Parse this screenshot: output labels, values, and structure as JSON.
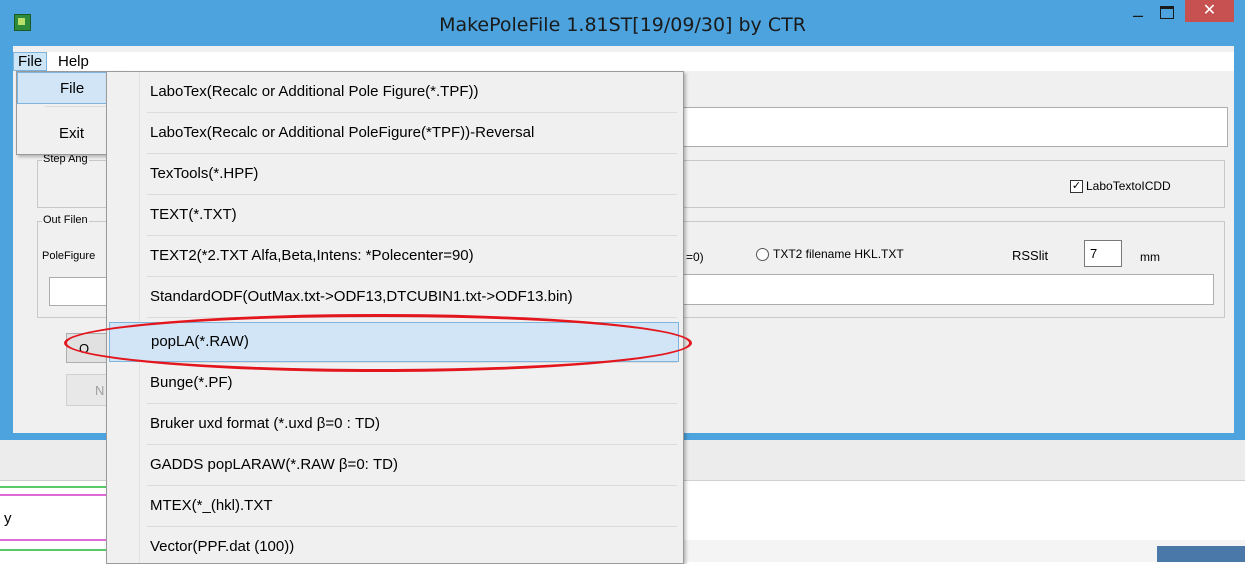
{
  "window": {
    "title": "MakePoleFile 1.81ST[19/09/30] by CTR",
    "minimize": "–",
    "close": "✕"
  },
  "menubar": {
    "file": "File",
    "help": "Help"
  },
  "file_menu": {
    "items": [
      {
        "label": "File",
        "has_submenu": true
      },
      {
        "label": "Exit"
      }
    ]
  },
  "file_submenu": {
    "items": [
      "LaboTex(Recalc or Additional Pole Figure(*.TPF))",
      "LaboTex(Recalc or Additional PoleFigure(*TPF))-Reversal",
      "TexTools(*.HPF)",
      "TEXT(*.TXT)",
      "TEXT2(*2.TXT Alfa,Beta,Intens: *Polecenter=90)",
      "StandardODF(OutMax.txt->ODF13,DTCUBIN1.txt->ODF13.bin)",
      "popLA(*.RAW)",
      "Bunge(*.PF)",
      "Bruker uxd format (*.uxd β=0 : TD)",
      "GADDS popLARAW(*.RAW β=0: TD)",
      "MTEX(*_(hkl).TXT",
      "Vector(PPF.dat (100))"
    ],
    "highlighted_index": 6
  },
  "background": {
    "step_angle_label": "Step Ang",
    "out_filename_label": "Out Filen",
    "pole_figure_label": "PoleFigure",
    "labotex_checkbox_label": "LaboTextoICDD",
    "labotex_checked": true,
    "checkmark": "✓",
    "e0_fragment": "=0)",
    "txt2_radio_label": "TXT2 filename  HKL.TXT",
    "rsslit_label": "RSSlit",
    "rsslit_value": "7",
    "mm_label": "mm",
    "button_o": "O",
    "button_n": "N",
    "lower_y": "y"
  },
  "colors": {
    "titlebar": "#4ca3de",
    "close_button": "#c75050",
    "highlight": "#d1e5f6",
    "annotation_ellipse": "#e4161d"
  }
}
